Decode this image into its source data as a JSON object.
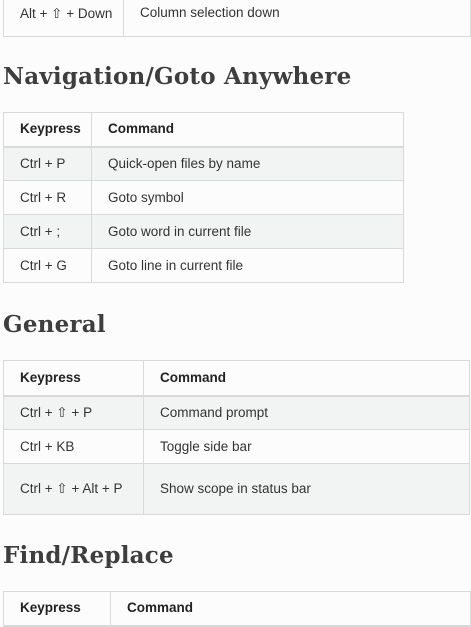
{
  "top_table": {
    "row": {
      "keypress": "Alt + ⇧ + Down",
      "command": "Column selection down"
    }
  },
  "sections": [
    {
      "title": "Navigation/Goto Anywhere",
      "headers": {
        "keypress": "Keypress",
        "command": "Command"
      },
      "rows": [
        {
          "keypress": "Ctrl + P",
          "command": "Quick-open files by name"
        },
        {
          "keypress": "Ctrl + R",
          "command": "Goto symbol"
        },
        {
          "keypress": "Ctrl + ;",
          "command": "Goto word in current file"
        },
        {
          "keypress": "Ctrl + G",
          "command": "Goto line in current file"
        }
      ]
    },
    {
      "title": "General",
      "headers": {
        "keypress": "Keypress",
        "command": "Command"
      },
      "rows": [
        {
          "keypress": "Ctrl + ⇧ + P",
          "command": "Command prompt"
        },
        {
          "keypress": "Ctrl + KB",
          "command": "Toggle side bar"
        },
        {
          "keypress": "Ctrl + ⇧ + Alt + P",
          "command": "Show scope in status bar"
        }
      ]
    },
    {
      "title": "Find/Replace",
      "headers": {
        "keypress": "Keypress",
        "command": "Command"
      },
      "rows": []
    }
  ]
}
